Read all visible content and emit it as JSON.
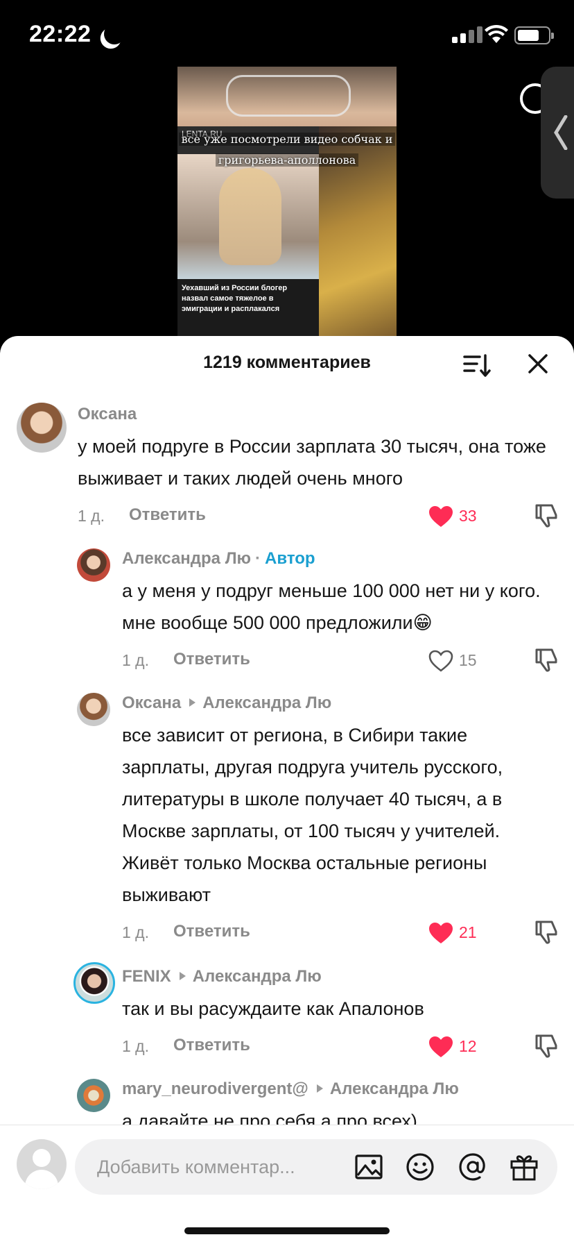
{
  "status": {
    "time": "22:22"
  },
  "video": {
    "overlay_line1": "все уже посмотрели видео собчак и",
    "overlay_line2": "григорьева-аполлонова",
    "lenta_logo": "LENTA.RU",
    "lenta_caption": "Уехавший из России блогер назвал самое тяжелое в эмиграции и расплакался"
  },
  "sheet": {
    "title": "1219 комментариев"
  },
  "comments": [
    {
      "user": "Оксана",
      "text": "у моей подруге в России зарплата 30 тысяч, она тоже выживает и таких людей очень много",
      "date": "1 д.",
      "reply": "Ответить",
      "likes": "33",
      "liked": true
    },
    {
      "user": "Александра Лю",
      "badge": "Автор",
      "text": "а у меня у подруг меньше 100 000 нет ни у кого. мне вообще 500 000 предложили😁",
      "date": "1 д.",
      "reply": "Ответить",
      "likes": "15",
      "liked": false
    },
    {
      "user": "Оксана",
      "reply_to": "Александра Лю",
      "text": "все зависит от региона, в Сибири такие зарплаты, другая подруга учитель русского, литературы в школе получает 40 тысяч, а в Москве зарплаты, от 100 тысяч у учителей. Живёт только Москва остальные регионы выживают",
      "date": "1 д.",
      "reply": "Ответить",
      "likes": "21",
      "liked": true
    },
    {
      "user": "FENIX",
      "reply_to": "Александра Лю",
      "text": "так и вы расуждаите как Апалонов",
      "date": "1 д.",
      "reply": "Ответить",
      "likes": "12",
      "liked": true
    },
    {
      "user": "mary_neurodivergent@",
      "reply_to": "Александра Лю",
      "text": "а давайте не про себя а про всех)"
    }
  ],
  "input": {
    "placeholder": "Добавить комментар..."
  },
  "colors": {
    "like_red": "#fe2c55",
    "author_blue": "#1a9fd0",
    "muted": "#8a8a8a"
  }
}
